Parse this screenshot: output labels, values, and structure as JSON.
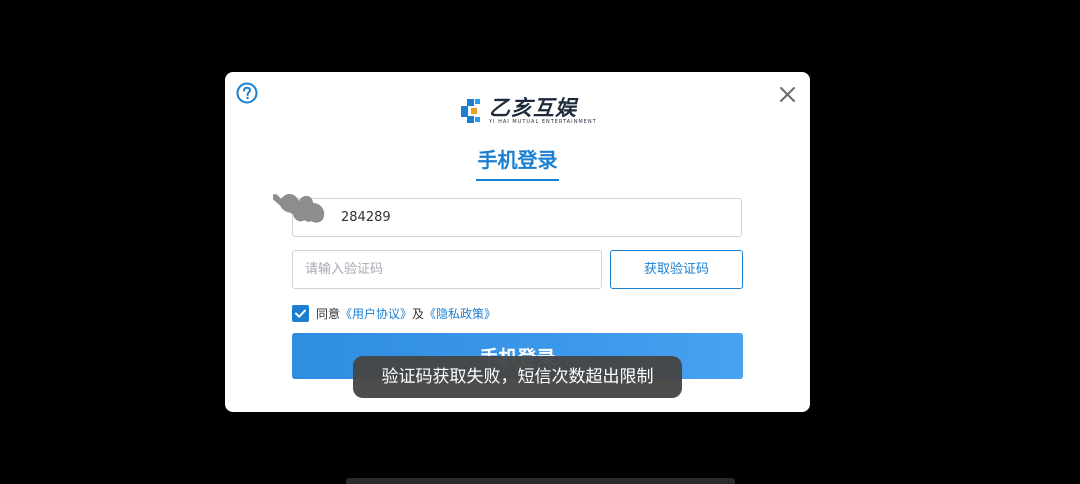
{
  "colors": {
    "accent": "#1b7fd1",
    "backdrop": "#000000",
    "dialog_bg": "#ffffff",
    "toast_bg": "#464646"
  },
  "dialog": {
    "help_icon": "question-circle-icon",
    "close_icon": "close-icon",
    "logo": {
      "name": "乙亥互娱",
      "subtitle": "YI HAI MUTUAL ENTERTAINMENT"
    },
    "title": "手机登录",
    "phone_input": {
      "value": "284289"
    },
    "code_input": {
      "placeholder": "请输入验证码",
      "value": ""
    },
    "get_code_label": "获取验证码",
    "agreement": {
      "checked": true,
      "prefix": "同意",
      "user_agreement": "《用户协议》",
      "joiner": "及",
      "privacy_policy": "《隐私政策》"
    },
    "login_button_label": "手机登录"
  },
  "toast": {
    "message": "验证码获取失败，短信次数超出限制"
  }
}
